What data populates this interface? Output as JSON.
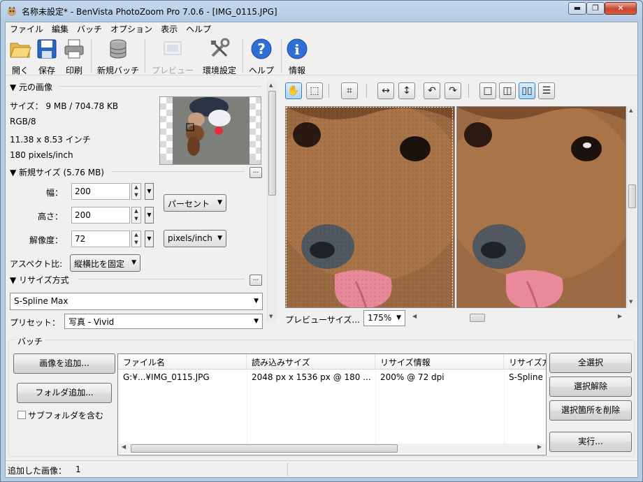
{
  "window": {
    "title": "名称未設定* - BenVista PhotoZoom Pro 7.0.6 - [IMG_0115.JPG]",
    "min": "▬",
    "max": "❐",
    "close": "✕"
  },
  "menu": [
    "ファイル",
    "編集",
    "バッチ",
    "オプション",
    "表示",
    "ヘルプ"
  ],
  "toolbar": {
    "open": "開く",
    "save": "保存",
    "print": "印刷",
    "new_batch": "新規バッチ",
    "preview": "プレビュー",
    "settings": "環境設定",
    "help": "ヘルプ",
    "info": "情報"
  },
  "original": {
    "header": "▼ 元の画像",
    "size": "サイズ： 9 MB / 704.78 KB",
    "mode": "RGB/8",
    "dimensions": "11.38 x 8.53 インチ",
    "resolution": "180 pixels/inch"
  },
  "newsize": {
    "header": "▼ 新規サイズ (5.76 MB)",
    "width_label": "幅：",
    "width": "200",
    "height_label": "高さ：",
    "height": "200",
    "res_label": "解像度：",
    "res": "72",
    "unit": "パーセント",
    "res_unit": "pixels/inch",
    "aspect_label": "アスペクト比:",
    "aspect": "縦横比を固定"
  },
  "resize": {
    "header": "▼ リサイズ方式",
    "method": "S-Spline Max",
    "preset_label": "プリセット：",
    "preset": "写真 - Vivid"
  },
  "preview": {
    "size_label": "プレビューサイズ...",
    "zoom": "175%"
  },
  "batch": {
    "header": "バッチ",
    "add_image": "画像を追加...",
    "add_folder": "フォルダ追加...",
    "subfolder": "サブフォルダを含む",
    "columns": [
      "ファイル名",
      "読み込みサイズ",
      "リサイズ情報",
      "リサイズ方"
    ],
    "rows": [
      [
        "G:¥...¥IMG_0115.JPG",
        "2048 px x 1536 px @ 180 ...",
        "200% @ 72 dpi",
        "S-Spline Max"
      ]
    ],
    "select_all": "全選択",
    "deselect": "選択解除",
    "delete_sel": "選択箇所を削除",
    "run": "実行..."
  },
  "status": {
    "label": "追加した画像：",
    "count": "1"
  },
  "colors": {
    "accent": "#3c7fb1",
    "titlebar": "#c4d8ee"
  }
}
